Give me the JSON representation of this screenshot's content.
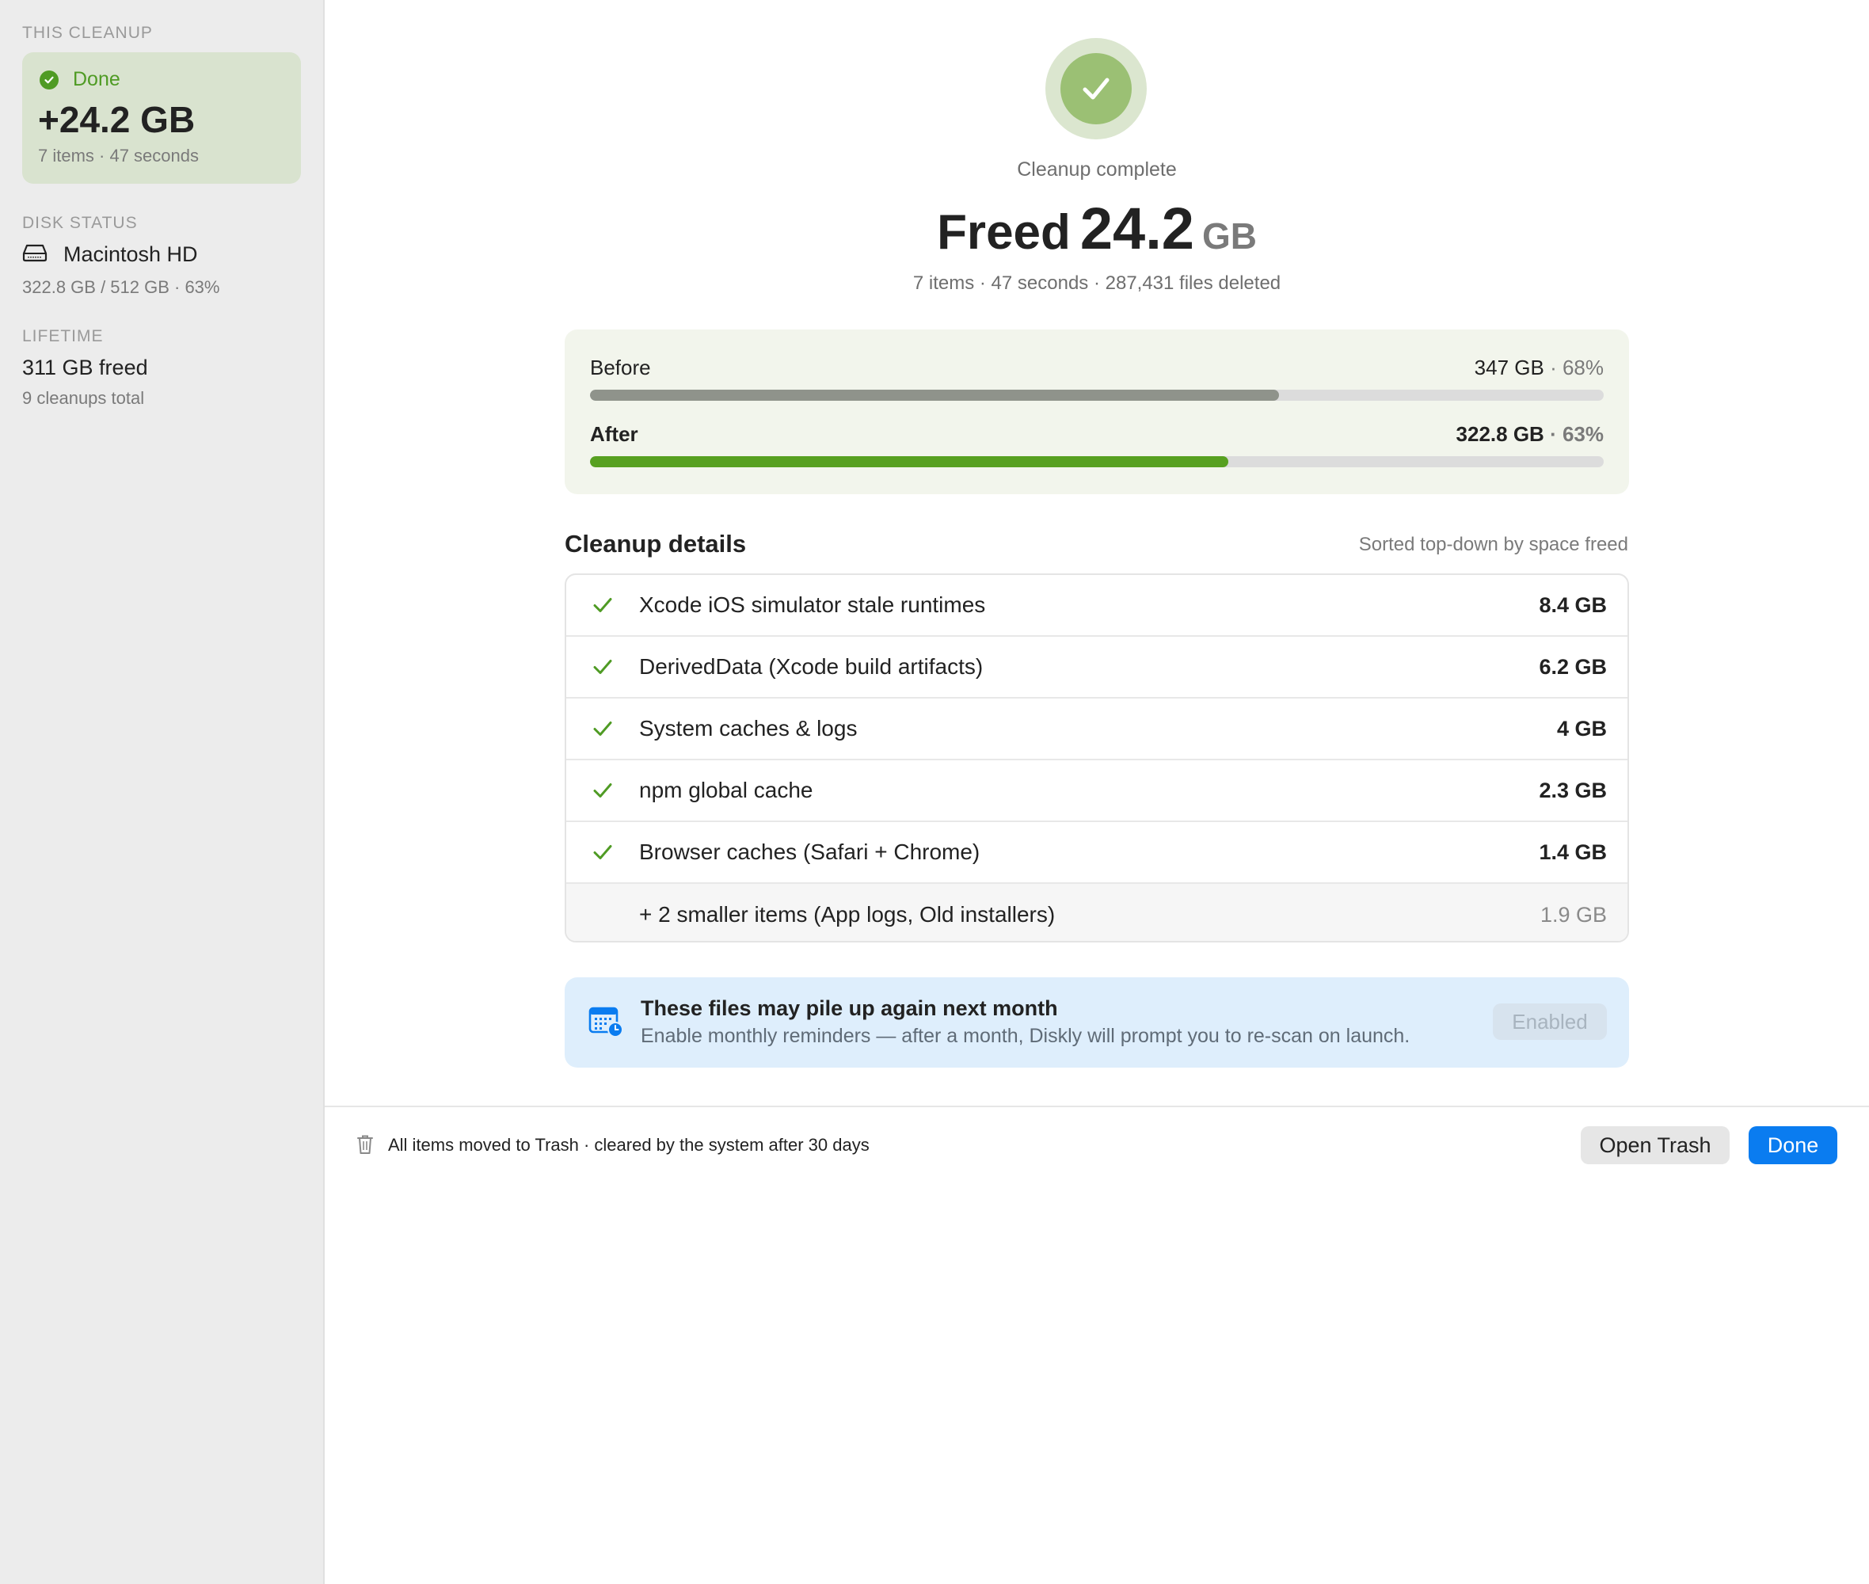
{
  "sidebar": {
    "this_cleanup_title": "THIS CLEANUP",
    "status": "Done",
    "amount": "+24.2 GB",
    "meta": "7 items · 47 seconds",
    "disk_status_title": "DISK STATUS",
    "disk_name": "Macintosh HD",
    "disk_meta": "322.8 GB / 512 GB · 63%",
    "lifetime_title": "LIFETIME",
    "lifetime_value": "311 GB freed",
    "lifetime_meta": "9 cleanups total"
  },
  "hero": {
    "label": "Cleanup complete",
    "freed_word": "Freed",
    "freed_number": "24.2",
    "freed_unit": "GB",
    "meta": "7 items · 47 seconds · 287,431 files deleted"
  },
  "usage": {
    "before": {
      "label": "Before",
      "size": "347 GB",
      "pct": "68%",
      "fill_fraction": 0.68,
      "color": "#8f938b"
    },
    "after": {
      "label": "After",
      "size": "322.8 GB",
      "pct": "63%",
      "fill_fraction": 0.63,
      "color": "#57a020"
    }
  },
  "details": {
    "title": "Cleanup details",
    "sort_note": "Sorted top-down by space freed",
    "rows": [
      {
        "label": "Xcode iOS simulator stale runtimes",
        "size": "8.4 GB"
      },
      {
        "label": "DerivedData (Xcode build artifacts)",
        "size": "6.2 GB"
      },
      {
        "label": "System caches & logs",
        "size": "4 GB"
      },
      {
        "label": "npm global cache",
        "size": "2.3 GB"
      },
      {
        "label": "Browser caches (Safari + Chrome)",
        "size": "1.4 GB"
      },
      {
        "label": "+ 2 smaller items (App logs, Old installers)",
        "size": "1.9 GB"
      }
    ]
  },
  "reminder": {
    "title": "These files may pile up again next month",
    "subtitle": "Enable monthly reminders — after a month, Diskly will prompt you to re-scan on launch.",
    "button": "Enabled"
  },
  "footer": {
    "text": "All items moved to Trash · cleared by the system after 30 days",
    "open_trash": "Open Trash",
    "done": "Done"
  },
  "colors": {
    "accent_green": "#4f9b24",
    "accent_blue": "#0a7cf0"
  }
}
